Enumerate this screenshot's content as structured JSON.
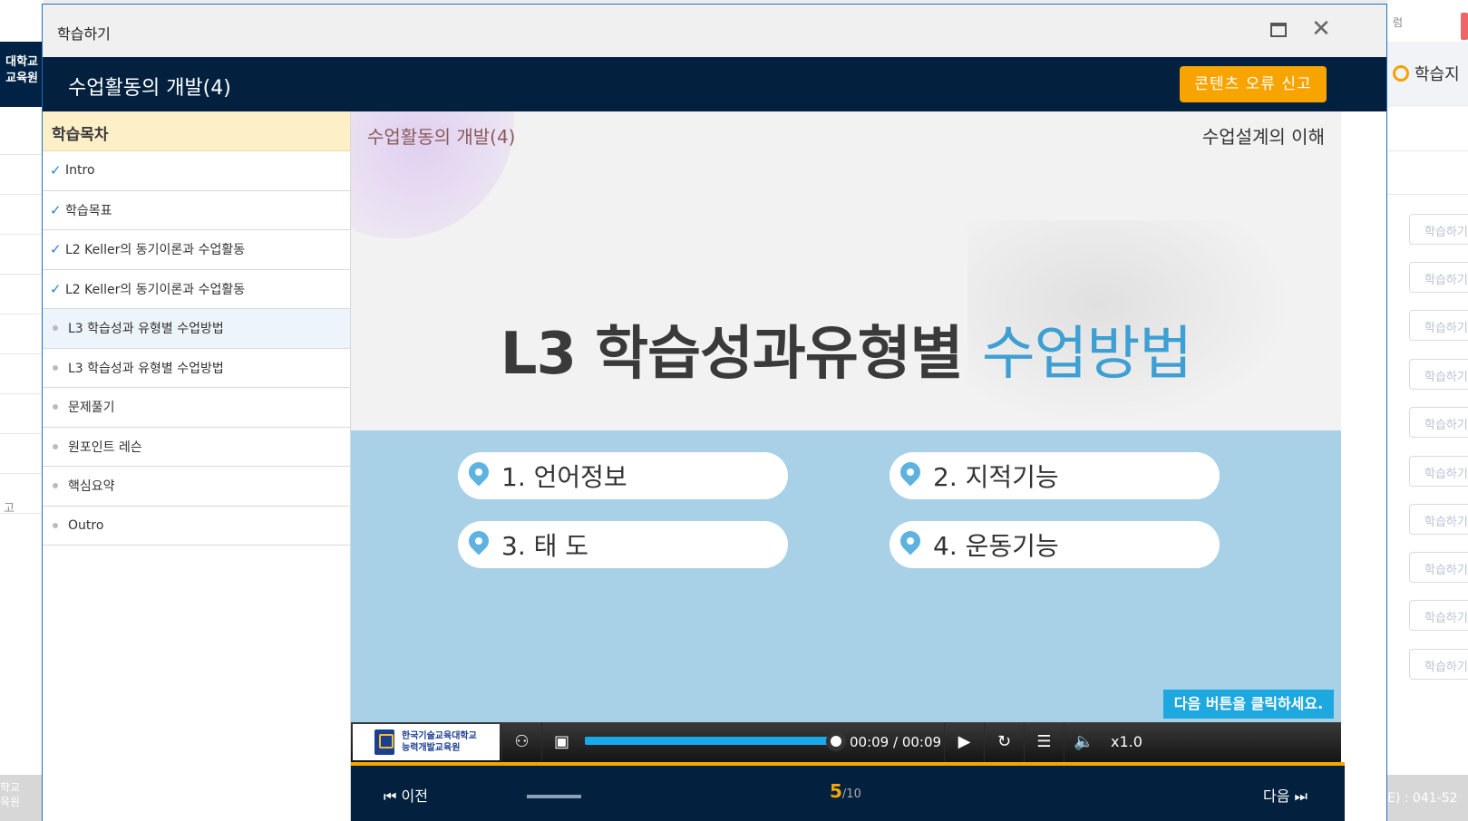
{
  "background": {
    "left_header": "대학교\n교육원",
    "left_side_text": "고",
    "left_footer": "학교\n육원",
    "right_top_text": "럼",
    "right_header": "학습지",
    "right_button_label": "학습하기",
    "right_footer": "E) : 041-52"
  },
  "window": {
    "title": "학습하기",
    "maximize_icon": "maximize-icon",
    "close_icon": "close-icon",
    "close_glyph": "✕"
  },
  "course": {
    "title": "수업활동의 개발(4)",
    "report_button": "콘텐츠 오류 신고"
  },
  "toc": {
    "heading": "학습목차",
    "items": [
      {
        "label": "Intro",
        "done": true
      },
      {
        "label": "학습목표",
        "done": true
      },
      {
        "label": "L2 Keller의 동기이론과 수업활동",
        "done": true
      },
      {
        "label": "L2 Keller의 동기이론과 수업활동",
        "done": true
      },
      {
        "label": "L3 학습성과 유형별 수업방법",
        "done": false,
        "active": true
      },
      {
        "label": "L3 학습성과 유형별 수업방법",
        "done": false
      },
      {
        "label": "문제풀기",
        "done": false
      },
      {
        "label": "원포인트 레슨",
        "done": false
      },
      {
        "label": "핵심요약",
        "done": false
      },
      {
        "label": "Outro",
        "done": false
      }
    ]
  },
  "slide": {
    "corner_left": "수업활동의 개발(4)",
    "corner_right": "수업설계의 이해",
    "heading_main": "L3 학습성과유형별 ",
    "heading_highlight": "수업방법",
    "options": [
      "1. 언어정보",
      "2. 지적기능",
      "3. 태 도",
      "4. 운동기능"
    ],
    "hint": "다음 버튼을 클릭하세요."
  },
  "player": {
    "logo_line1": "한국기술교육대학교",
    "logo_line2": "능력개발교육원",
    "progress": 1.0,
    "time": "00:09 / 00:09",
    "speed": "x1.0",
    "icons": [
      "person-icon",
      "folder-icon",
      "play-icon",
      "replay-icon",
      "list-icon",
      "volume-icon"
    ],
    "glyphs": {
      "person": "⚇",
      "folder": "▣",
      "play": "▶",
      "replay": "↻",
      "list": "☰",
      "volume": "🔈"
    }
  },
  "nav": {
    "prev": "⏮ 이전",
    "current_page": "5",
    "total_pages": "/10",
    "next": "다음 ⏭"
  },
  "colors": {
    "navy": "#03213f",
    "accent_orange": "#f7a400",
    "accent_blue": "#19a8e8",
    "check_blue": "#2383d6"
  }
}
